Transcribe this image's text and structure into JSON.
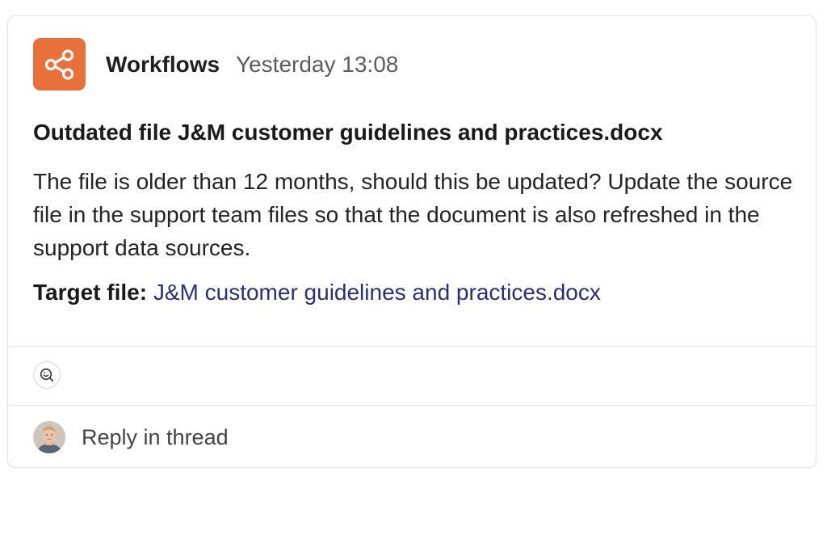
{
  "message": {
    "sender": "Workflows",
    "timestamp": "Yesterday 13:08",
    "app_icon": "share-network-icon",
    "accent_color": "#e8703a",
    "title": "Outdated file J&M customer guidelines and practices.docx",
    "body": "The file is older than 12 months, should this be updated? Update the source file in the support team files so that the document is also refreshed in the support data sources.",
    "target_label": "Target file:",
    "target_link": "J&M customer guidelines and practices.docx",
    "link_color": "#2b2f73"
  },
  "actions": {
    "reaction_icon": "add-reaction-icon"
  },
  "reply": {
    "label": "Reply in thread",
    "avatar": "user-avatar"
  }
}
